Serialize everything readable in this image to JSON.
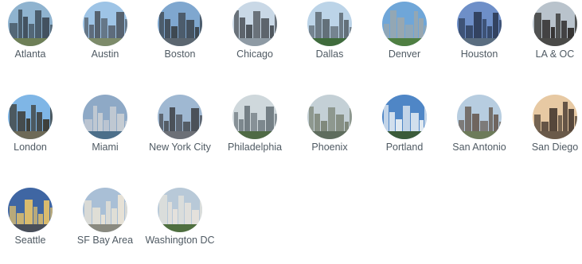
{
  "cities": [
    {
      "label": "Atlanta",
      "icon": "atlanta-skyline-icon",
      "sky": "#8fb3cf",
      "ground": "#6e7f57",
      "bldg": "#3f4d5a"
    },
    {
      "label": "Austin",
      "icon": "austin-skyline-icon",
      "sky": "#9ec4e6",
      "ground": "#7d8b6a",
      "bldg": "#525d68"
    },
    {
      "label": "Boston",
      "icon": "boston-skyline-icon",
      "sky": "#7fa7cf",
      "ground": "#5b6670",
      "bldg": "#3b434b"
    },
    {
      "label": "Chicago",
      "icon": "chicago-skyline-icon",
      "sky": "#c9d8e6",
      "ground": "#8e9aa4",
      "bldg": "#4a5056"
    },
    {
      "label": "Dallas",
      "icon": "dallas-skyline-icon",
      "sky": "#bcd4e8",
      "ground": "#3f6b3c",
      "bldg": "#5e6a73"
    },
    {
      "label": "Denver",
      "icon": "denver-skyline-icon",
      "sky": "#6fa6d8",
      "ground": "#4f7f42",
      "bldg": "#9aa7ae"
    },
    {
      "label": "Houston",
      "icon": "houston-skyline-icon",
      "sky": "#6e8fc8",
      "ground": "#5a6d80",
      "bldg": "#2f3f5c"
    },
    {
      "label": "LA & OC",
      "icon": "la-oc-skyline-icon",
      "sky": "#b9c3cc",
      "ground": "#4a4a48",
      "bldg": "#2e2c2a"
    },
    {
      "label": "London",
      "icon": "london-skyline-icon",
      "sky": "#7fb6e6",
      "ground": "#6d6a58",
      "bldg": "#3b3a33"
    },
    {
      "label": "Miami",
      "icon": "miami-skyline-icon",
      "sky": "#8ea9c6",
      "ground": "#4c6f8a",
      "bldg": "#c8ced4"
    },
    {
      "label": "New York City",
      "icon": "new-york-skyline-icon",
      "sky": "#9fb8d2",
      "ground": "#6c7077",
      "bldg": "#474b52"
    },
    {
      "label": "Philadelphia",
      "icon": "philadelphia-skyline-icon",
      "sky": "#cfd8dc",
      "ground": "#4f6a45",
      "bldg": "#6f7a80"
    },
    {
      "label": "Phoenix",
      "icon": "phoenix-skyline-icon",
      "sky": "#c4d0d6",
      "ground": "#5f6d5e",
      "bldg": "#7c8577"
    },
    {
      "label": "Portland",
      "icon": "portland-skyline-icon",
      "sky": "#4f86c6",
      "ground": "#3b5b3a",
      "bldg": "#e8eef3"
    },
    {
      "label": "San Antonio",
      "icon": "san-antonio-skyline-icon",
      "sky": "#b7cde0",
      "ground": "#6d7b5a",
      "bldg": "#6a5f57"
    },
    {
      "label": "San Diego",
      "icon": "san-diego-skyline-icon",
      "sky": "#e7c9a3",
      "ground": "#6a5a4a",
      "bldg": "#4e4036"
    },
    {
      "label": "Seattle",
      "icon": "seattle-skyline-icon",
      "sky": "#3f66a3",
      "ground": "#4a4f59",
      "bldg": "#e1c06c"
    },
    {
      "label": "SF Bay Area",
      "icon": "sf-bay-area-skyline-icon",
      "sky": "#a9bfd6",
      "ground": "#8a8a80",
      "bldg": "#e9e3d6"
    },
    {
      "label": "Washington DC",
      "icon": "washington-dc-skyline-icon",
      "sky": "#b8c9d8",
      "ground": "#4f6f3f",
      "bldg": "#e6e3dc"
    }
  ]
}
